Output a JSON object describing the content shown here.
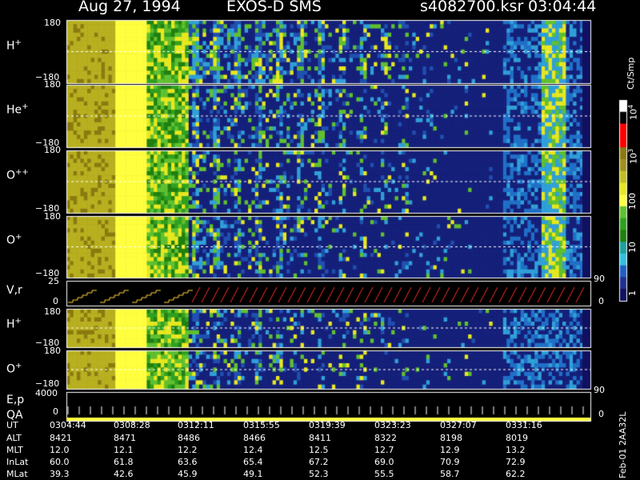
{
  "header": {
    "date": "Aug 27, 1994",
    "instrument": "EXOS-D SMS",
    "file": "s4082700.ksr",
    "time": "03:04:44"
  },
  "panels": [
    {
      "id": "h-plus",
      "label": "H",
      "sup": "+",
      "top": "180",
      "bottom": "−180"
    },
    {
      "id": "he-plus",
      "label": "He",
      "sup": "+",
      "top": "180",
      "bottom": "−180"
    },
    {
      "id": "o-plusplus",
      "label": "O",
      "sup": "++",
      "top": "180",
      "bottom": "−180"
    },
    {
      "id": "o-plus",
      "label": "O",
      "sup": "+",
      "top": "180",
      "bottom": "−180"
    },
    {
      "id": "v-r",
      "label": "V,r",
      "sup": "",
      "top": "25",
      "bottom": "0"
    },
    {
      "id": "h-plus-2",
      "label": "H",
      "sup": "+",
      "top": "180",
      "bottom": "−180"
    },
    {
      "id": "o-plus-2",
      "label": "O",
      "sup": "+",
      "top": "180",
      "bottom": "−180"
    },
    {
      "id": "ep-qa",
      "label": "E,p",
      "sup": "",
      "top": "4000",
      "bottom": "0",
      "label2": "QA"
    }
  ],
  "right_axis": {
    "top_90": "90",
    "bottom_0": "0",
    "lower_90": "90",
    "lower_0": "0"
  },
  "colorbar": {
    "unit": "Ct/Smp",
    "labels": [
      {
        "base": "10",
        "exp": "4"
      },
      {
        "base": "10",
        "exp": "3"
      },
      {
        "base": "100",
        "exp": ""
      },
      {
        "base": "10",
        "exp": ""
      },
      {
        "base": "1",
        "exp": ""
      }
    ],
    "colors": [
      "#ffffff",
      "#000000",
      "#ff0000",
      "#ff0000",
      "#8a7a10",
      "#a09020",
      "#c0c020",
      "#e8e820",
      "#ffff40",
      "#60c030",
      "#30a020",
      "#208010",
      "#20a0a0",
      "#30c0e0",
      "#2060c0",
      "#203090",
      "#101060"
    ]
  },
  "footer": {
    "rows": [
      {
        "name": "UT",
        "values": [
          "0304:44",
          "0308:28",
          "0312:11",
          "0315:55",
          "0319:39",
          "0323:23",
          "0327:07",
          "0331:16"
        ]
      },
      {
        "name": "ALT",
        "values": [
          "8421",
          "8471",
          "8486",
          "8466",
          "8411",
          "8322",
          "8198",
          "8019"
        ]
      },
      {
        "name": "MLT",
        "values": [
          "12.0",
          "12.1",
          "12.2",
          "12.4",
          "12.5",
          "12.7",
          "12.9",
          "13.2"
        ]
      },
      {
        "name": "InLat",
        "values": [
          "60.0",
          "61.8",
          "63.6",
          "65.4",
          "67.2",
          "69.0",
          "70.9",
          "72.9"
        ]
      },
      {
        "name": "MLat",
        "values": [
          "39.3",
          "42.6",
          "45.9",
          "49.1",
          "52.3",
          "55.5",
          "58.7",
          "62.2"
        ]
      }
    ],
    "stamp": "Feb-01  2AA32L"
  },
  "chart_data": {
    "type": "heatmap",
    "title": "Aug 27, 1994   EXOS-D SMS",
    "xlabel": "UT",
    "x_ticks": [
      "0304:44",
      "0308:28",
      "0312:11",
      "0315:55",
      "0319:39",
      "0323:23",
      "0327:07",
      "0331:16"
    ],
    "panels": [
      "H+",
      "He+",
      "O++",
      "O+",
      "V,r",
      "H+",
      "O+",
      "E,p QA"
    ],
    "ylim_angle": [
      -180,
      180
    ],
    "ylim_vr": [
      0,
      25
    ],
    "ylim_ep": [
      0,
      4000
    ],
    "colorscale": {
      "unit": "Ct/Smp",
      "log": true,
      "range": [
        1,
        10000
      ]
    }
  }
}
